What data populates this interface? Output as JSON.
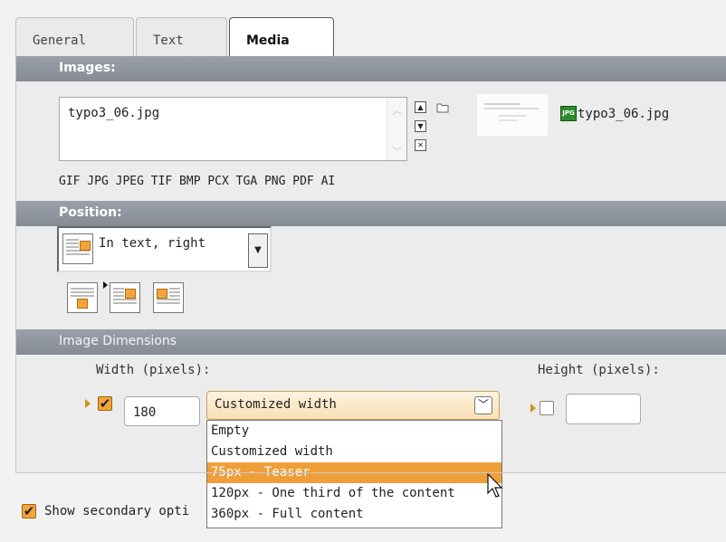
{
  "tabs": [
    {
      "label": "General"
    },
    {
      "label": "Text"
    },
    {
      "label": "Media"
    }
  ],
  "images_section": {
    "title": "Images:",
    "file_value": "typo3_06.jpg",
    "thumbnail_filename": "typo3_06.jpg",
    "file_badge": "JPG",
    "allowed_types": "GIF JPG JPEG TIF BMP PCX TGA PNG PDF AI"
  },
  "position_section": {
    "title": "Position:",
    "selected": "In text, right"
  },
  "dimensions_section": {
    "title": "Image Dimensions",
    "width_label": "Width (pixels):",
    "height_label": "Height (pixels):",
    "width_value": "180",
    "height_value": "",
    "width_mode_selected": "Customized width",
    "width_options": [
      "Empty",
      "Customized width",
      "75px - Teaser",
      "120px - One third of the content",
      "360px - Full content"
    ],
    "highlighted_option_index": 2
  },
  "footer": {
    "show_secondary_label": "Show secondary opti"
  },
  "colors": {
    "header": "#8e939c",
    "accent": "#ee9f3a"
  }
}
